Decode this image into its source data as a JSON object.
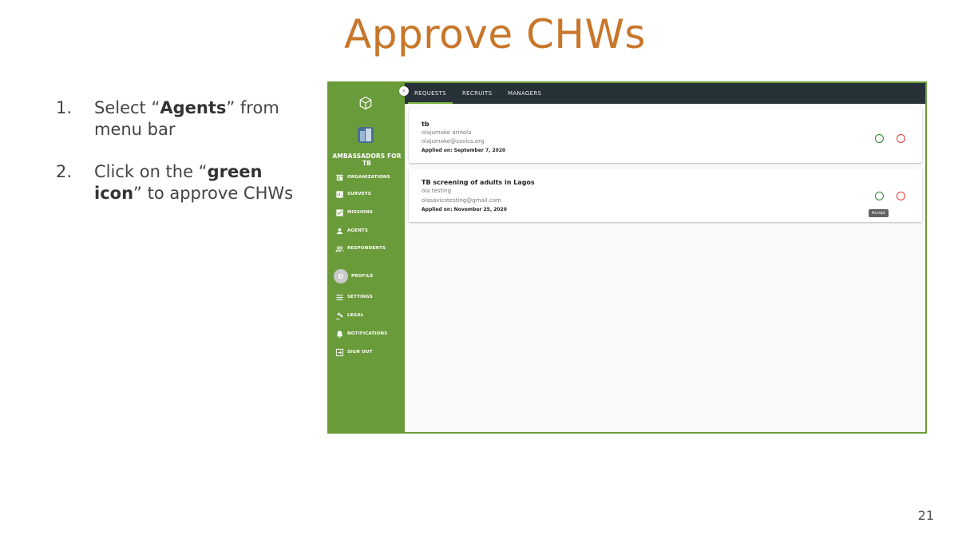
{
  "slide": {
    "title": "Approve CHWs",
    "page_number": "21",
    "steps": [
      {
        "num": "1.",
        "pre": "Select “",
        "bold": "Agents",
        "post": "” from menu bar"
      },
      {
        "num": "2.",
        "pre": "Click on the “",
        "bold": "green icon",
        "post": "” to approve CHWs"
      }
    ]
  },
  "app": {
    "org_name": "AMBASSADORS FOR TB",
    "collapse_icon": "‹",
    "nav": [
      {
        "label": "ORGANIZATIONS",
        "icon": "store-icon"
      },
      {
        "label": "SURVEYS",
        "icon": "bar-chart-icon"
      },
      {
        "label": "MISSIONS",
        "icon": "check-box-icon"
      },
      {
        "label": "AGENTS",
        "icon": "person-icon"
      },
      {
        "label": "RESPONDENTS",
        "icon": "people-icon"
      },
      {
        "label": "PROFILE",
        "icon": "avatar",
        "avatar_letter": "O"
      },
      {
        "label": "SETTINGS",
        "icon": "sliders-icon"
      },
      {
        "label": "LEGAL",
        "icon": "gavel-icon"
      },
      {
        "label": "NOTIFICATIONS",
        "icon": "bell-icon"
      },
      {
        "label": "SIGN OUT",
        "icon": "sign-out-icon"
      }
    ],
    "tabs": [
      {
        "label": "REQUESTS",
        "active": true
      },
      {
        "label": "RECRUITS",
        "active": false
      },
      {
        "label": "MANAGERS",
        "active": false
      }
    ],
    "requests": [
      {
        "title": "tb",
        "name": "olajumoke arinola",
        "email": "olajumoke@savics.org",
        "applied": "Applied on: September 7, 2020"
      },
      {
        "title": "TB screening of adults in Lagos",
        "name": "ola testing",
        "email": "olasavicstesting@gmail.com",
        "applied": "Applied on: November 25, 2020"
      }
    ],
    "tooltip": "Accept",
    "colors": {
      "sidebar": "#6a9b3b",
      "topbar": "#263238",
      "accept": "#2e7d32",
      "reject": "#e53935",
      "title": "#c8762a"
    }
  }
}
